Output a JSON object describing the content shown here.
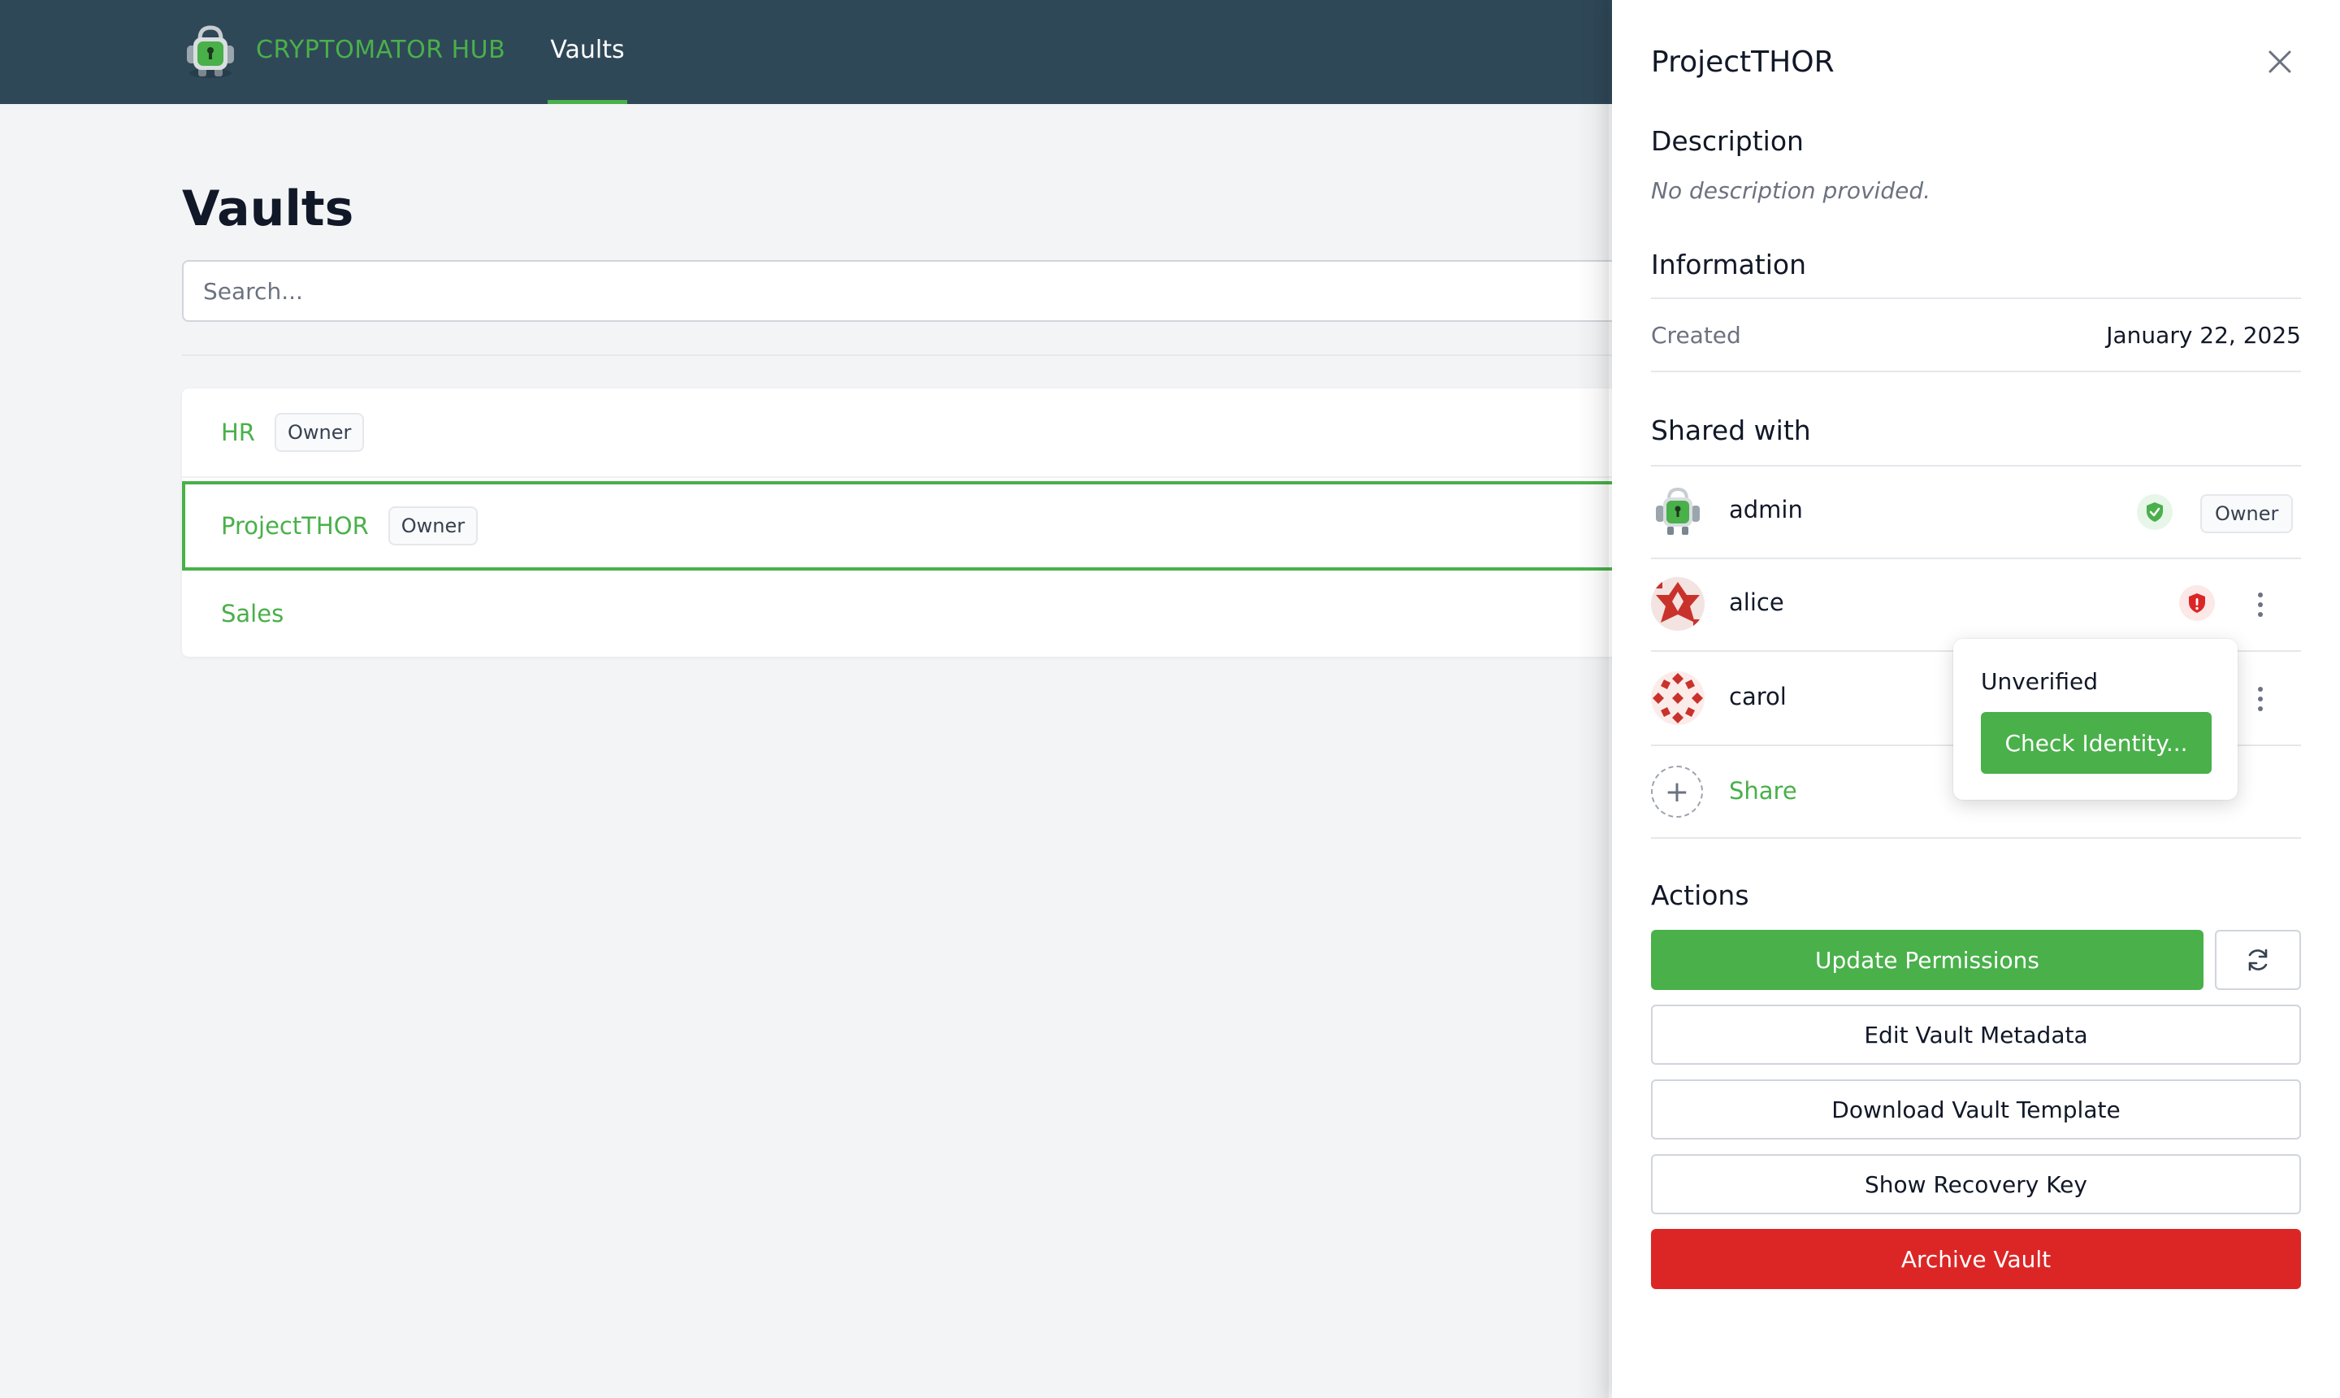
{
  "header": {
    "brand": "CRYPTOMATOR HUB",
    "nav_tabs": [
      {
        "label": "Vaults",
        "active": true
      }
    ],
    "colors": {
      "bar": "#2f4858",
      "accent": "#49b04a"
    }
  },
  "main": {
    "title": "Vaults",
    "search": {
      "placeholder": "Search...",
      "value": ""
    },
    "vaults": [
      {
        "name": "HR",
        "badge": "Owner",
        "selected": false
      },
      {
        "name": "ProjectTHOR",
        "badge": "Owner",
        "selected": true
      },
      {
        "name": "Sales",
        "badge": "",
        "selected": false
      }
    ]
  },
  "drawer": {
    "title": "ProjectTHOR",
    "description": {
      "heading": "Description",
      "text": "No description provided."
    },
    "information": {
      "heading": "Information",
      "created_label": "Created",
      "created_value": "January 22, 2025"
    },
    "shared_with": {
      "heading": "Shared with",
      "members": [
        {
          "name": "admin",
          "verified": true,
          "badge": "Owner",
          "icon": "shield-check-icon"
        },
        {
          "name": "alice",
          "verified": false,
          "badge": "",
          "icon": "shield-alert-icon"
        },
        {
          "name": "carol",
          "verified": false,
          "badge": "",
          "icon": ""
        }
      ],
      "share_label": "Share"
    },
    "popover": {
      "label": "Unverified",
      "button": "Check Identity..."
    },
    "actions": {
      "heading": "Actions",
      "update_permissions": "Update Permissions",
      "edit_metadata": "Edit Vault Metadata",
      "download_template": "Download Vault Template",
      "show_recovery_key": "Show Recovery Key",
      "archive_vault": "Archive Vault"
    }
  }
}
